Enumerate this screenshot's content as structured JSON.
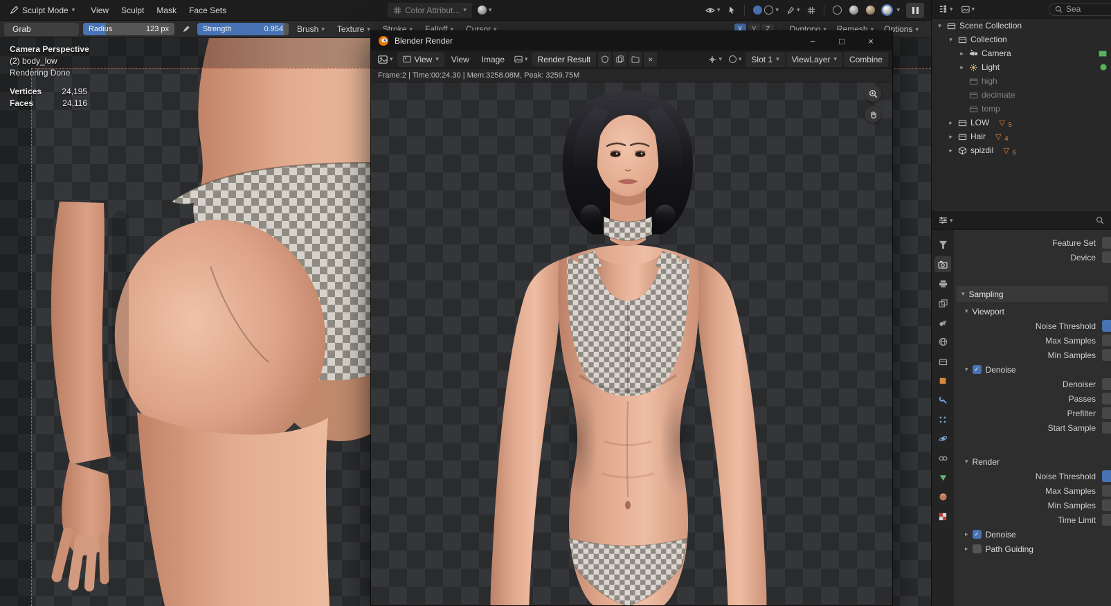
{
  "colors": {
    "accent_blue": "#4772b3",
    "selection_orange": "#e8873c",
    "header_bg": "#1d1d1d"
  },
  "icons": {
    "caret": "▾",
    "chevron_right": "▸",
    "chevron_down": "▾",
    "check": "✓",
    "close": "×",
    "minimize": "−",
    "maximize": "□",
    "badge_triangle": "▽"
  },
  "topbar": {
    "mode_label": "Sculpt Mode",
    "menu_view": "View",
    "menu_sculpt": "Sculpt",
    "menu_mask": "Mask",
    "menu_face_sets": "Face Sets",
    "color_attribute": "Color Attribut..."
  },
  "toolbar": {
    "tool": "Grab",
    "radius_label": "Radius",
    "radius_value": "123 px",
    "strength_label": "Strength",
    "strength_value": "0.954",
    "brush": "Brush",
    "texture": "Texture",
    "stroke": "Stroke",
    "falloff": "Falloff",
    "cursor": "Cursor",
    "sym_x": "X",
    "sym_y": "Y",
    "sym_z": "Z",
    "dyntopo": "Dyntopo",
    "remesh": "Remesh",
    "options": "Options"
  },
  "viewport": {
    "camera_label": "Camera Perspective",
    "object_label": "(2) body_low",
    "status_label": "Rendering Done",
    "vertices_label": "Vertices",
    "vertices_value": "24,195",
    "faces_label": "Faces",
    "faces_value": "24,116"
  },
  "render_window": {
    "title": "Blender Render",
    "mode": "View",
    "menu_view": "View",
    "menu_image": "Image",
    "datablock": "Render Result",
    "slot": "Slot 1",
    "layer": "ViewLayer",
    "pass": "Combine",
    "status": "Frame:2 | Time:00:24.30 | Mem:3258.08M, Peak: 3259.75M"
  },
  "outliner": {
    "search_placeholder": "Sea",
    "rows": [
      {
        "label": "Scene Collection"
      },
      {
        "label": "Collection"
      },
      {
        "label": "Camera"
      },
      {
        "label": "Light"
      },
      {
        "label": "high"
      },
      {
        "label": "decimate"
      },
      {
        "label": "temp"
      },
      {
        "label": "LOW",
        "badge": "5"
      },
      {
        "label": "Hair",
        "badge": "4"
      },
      {
        "label": "spizdil",
        "badge": "6"
      }
    ]
  },
  "properties": {
    "feature_set": "Feature Set",
    "device": "Device",
    "sampling": "Sampling",
    "viewport": "Viewport",
    "noise_threshold": "Noise Threshold",
    "max_samples": "Max Samples",
    "min_samples": "Min Samples",
    "denoise": "Denoise",
    "denoiser": "Denoiser",
    "passes": "Passes",
    "prefilter": "Prefilter",
    "start_sample": "Start Sample",
    "render": "Render",
    "noise_threshold_render": "Noise Threshold",
    "max_samples_render": "Max Samples",
    "min_samples_render": "Min Samples",
    "time_limit": "Time Limit",
    "denoise_render": "Denoise",
    "path_guiding": "Path Guiding"
  }
}
